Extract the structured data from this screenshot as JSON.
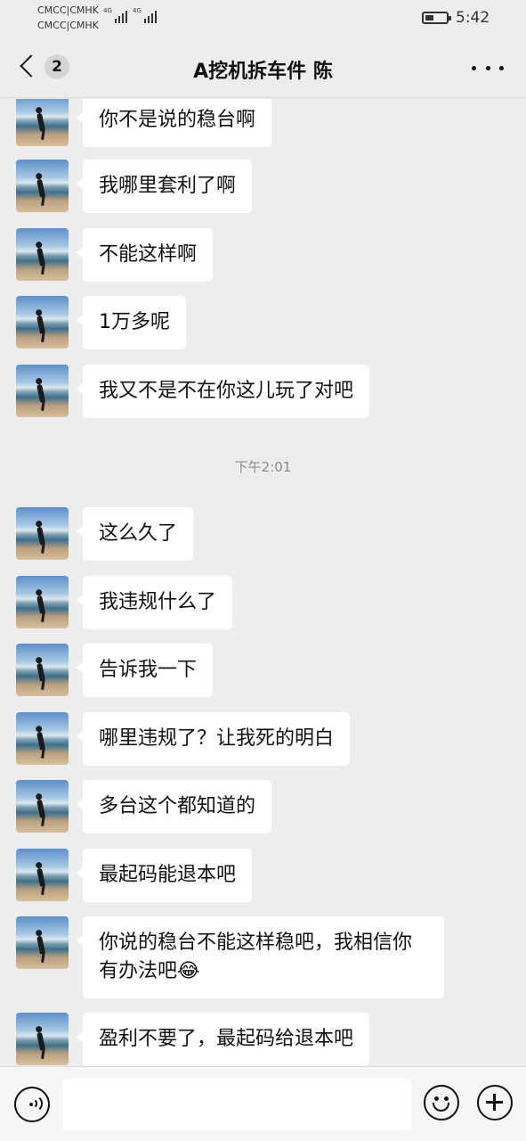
{
  "status_bar": {
    "carrier_line1": "CMCC|CMHK",
    "carrier_line2": "CMCC|CMHK",
    "network1": "4G",
    "network2": "4G",
    "time": "5:42",
    "battery_level": 0.3
  },
  "nav": {
    "back_badge": "2",
    "title": "A挖机拆车件 陈",
    "back_icon": "chevron-left-icon",
    "more_icon": "more-dots-icon"
  },
  "messages": [
    {
      "text": "你不是说的稳台啊"
    },
    {
      "text": "我哪里套利了啊"
    },
    {
      "text": "不能这样啊"
    },
    {
      "text": "1万多呢"
    },
    {
      "text": "我又不是不在你这儿玩了对吧"
    },
    {
      "text": "这么久了"
    },
    {
      "text": "我违规什么了"
    },
    {
      "text": "告诉我一下"
    },
    {
      "text": "哪里违规了？让我死的明白"
    },
    {
      "text": "多台这个都知道的"
    },
    {
      "text": "最起码能退本吧"
    },
    {
      "text": "你说的稳台不能这样稳吧，我相信你有办法吧😂"
    },
    {
      "text": "盈利不要了，最起码给退本吧"
    }
  ],
  "time_divider": "下午2:01",
  "input_bar": {
    "placeholder": "",
    "voice_icon": "voice-icon",
    "emoji_icon": "emoji-icon",
    "plus_icon": "plus-icon"
  },
  "colors": {
    "background": "#ededed",
    "bubble": "#ffffff",
    "text": "#111111",
    "timestamp": "#8a8a8a"
  }
}
